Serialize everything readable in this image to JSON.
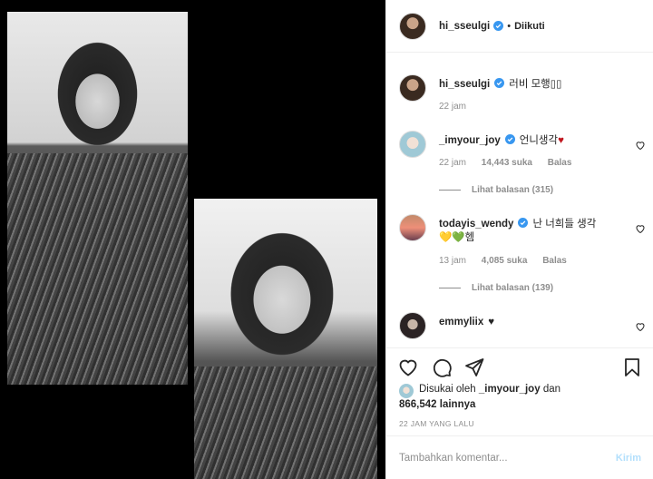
{
  "post": {
    "author": "hi_sseulgi",
    "follow_status": "Diikuti",
    "separator": "•"
  },
  "caption": {
    "username": "hi_sseulgi",
    "text": "러비 모행▯▯",
    "time": "22 jam"
  },
  "comments": [
    {
      "username": "_imyour_joy",
      "text": "언니생각",
      "emoji": "♥",
      "time": "22 jam",
      "likes": "14,443 suka",
      "reply_label": "Balas",
      "view_replies": "Lihat balasan (315)"
    },
    {
      "username": "todayis_wendy",
      "text": "난 너희들 생각",
      "text_line2": "헴",
      "emoji_line2": "💛💚",
      "time": "13 jam",
      "likes": "4,085 suka",
      "reply_label": "Balas",
      "view_replies": "Lihat balasan (139)"
    },
    {
      "username": "emmyliix",
      "text": "♥"
    }
  ],
  "actions": {
    "liked_by_prefix": "Disukai oleh",
    "liked_by_user": "_imyour_joy",
    "liked_by_and": "dan",
    "liked_count": "866,542 lainnya",
    "timestamp": "22 JAM YANG LALU"
  },
  "comment_box": {
    "placeholder": "Tambahkan komentar...",
    "post_label": "Kirim"
  },
  "colors": {
    "verified": "#3897f0",
    "heart_red": "#c0161e",
    "muted": "#8e8e8e",
    "post_disabled": "#b2dffc"
  }
}
